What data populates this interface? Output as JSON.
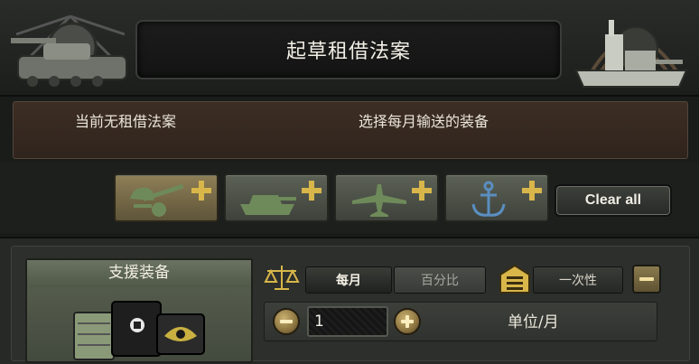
{
  "header": {
    "title": "起草租借法案"
  },
  "info": {
    "left_text": "当前无租借法案",
    "right_text": "选择每月输送的装备"
  },
  "tabs": [
    {
      "name": "infantry",
      "icon": "infantry-gun-icon",
      "active": true
    },
    {
      "name": "armor",
      "icon": "tank-icon",
      "active": false
    },
    {
      "name": "air",
      "icon": "plane-icon",
      "active": false
    },
    {
      "name": "naval",
      "icon": "anchor-icon",
      "active": false
    }
  ],
  "clear_all_label": "Clear all",
  "equipment": {
    "title": "支援装备",
    "icon": "support-equipment-icon"
  },
  "mode": {
    "monthly_label": "每月",
    "percent_label": "百分比",
    "once_label": "一次性",
    "selected": "每月"
  },
  "quantity": {
    "value": "1",
    "unit_label": "单位/月"
  },
  "colors": {
    "gold": "#d8b64a",
    "info_bg": "#3d2e24",
    "tab_active": "#8e7f57"
  }
}
